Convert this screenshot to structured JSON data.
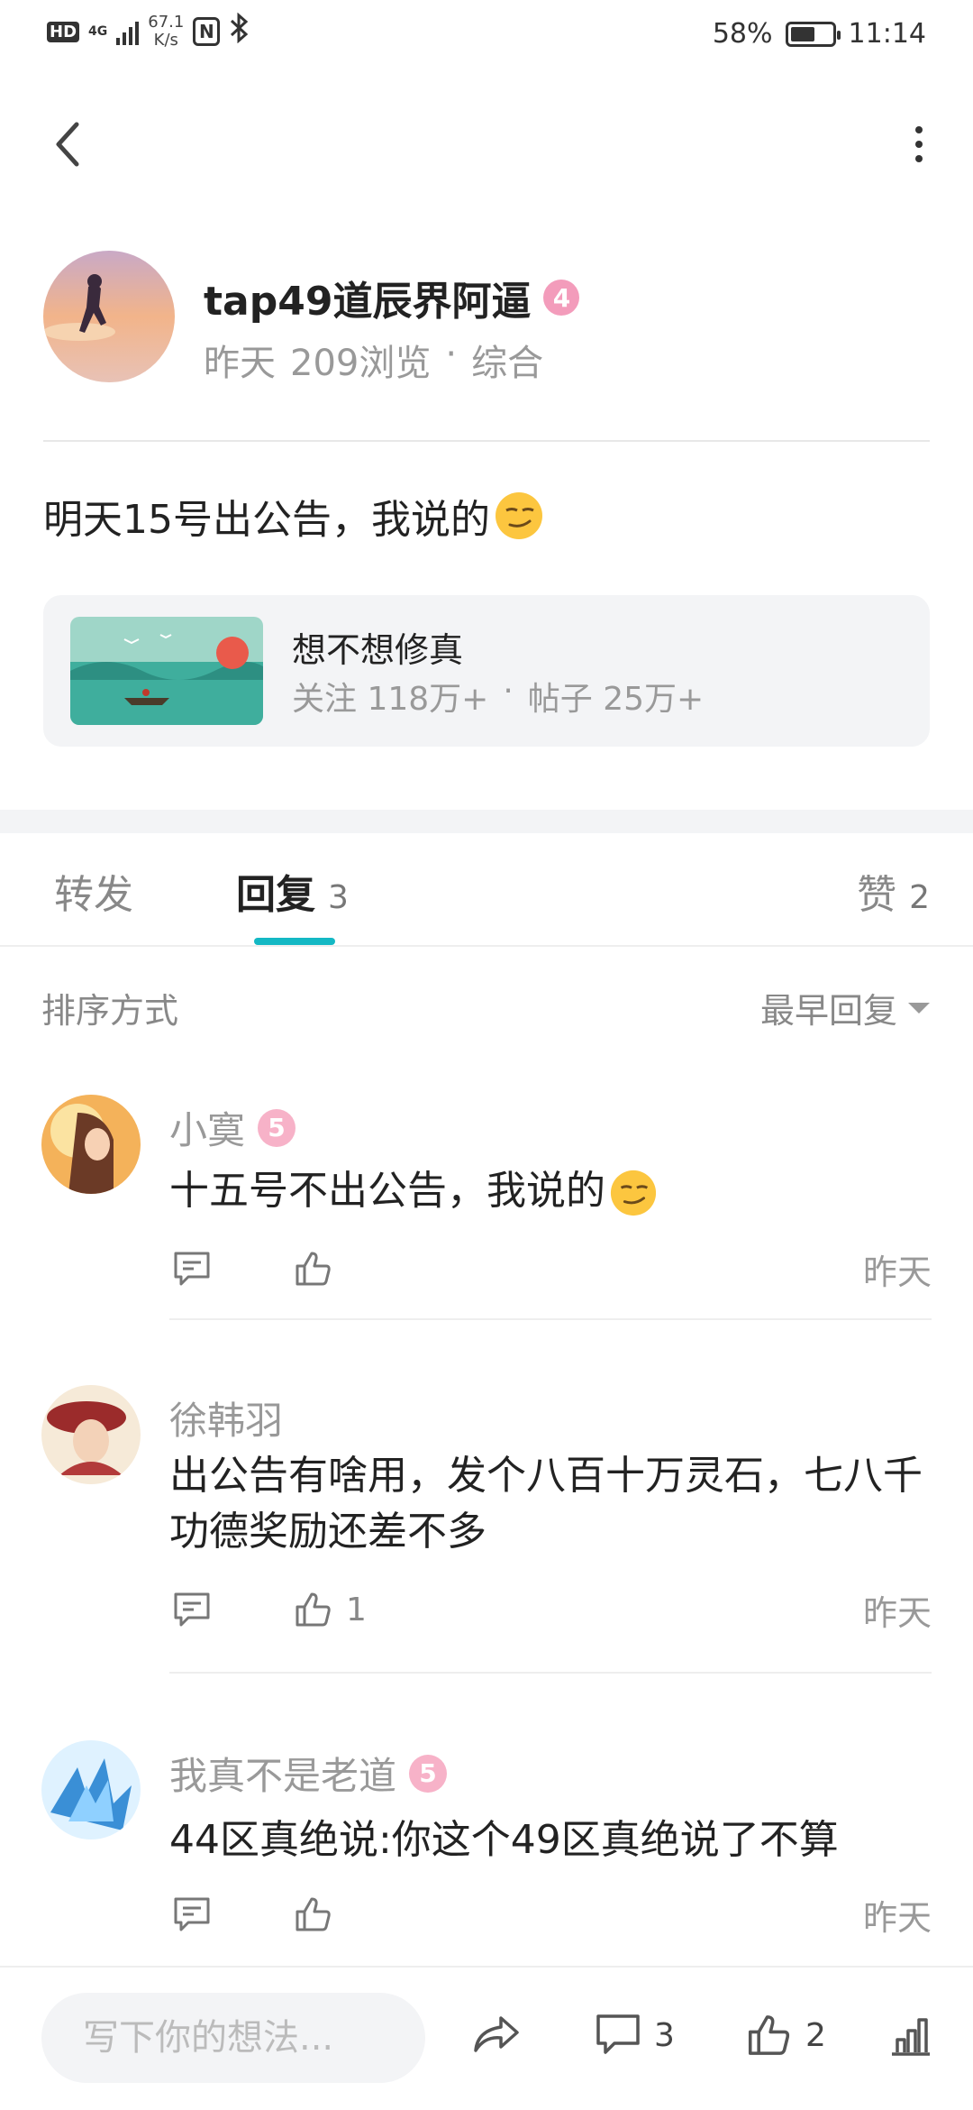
{
  "status_bar": {
    "hd": "HD",
    "network": "4G",
    "speed_value": "67.1",
    "speed_unit": "K/s",
    "battery_text": "58%",
    "battery_level": 0.58,
    "time": "11:14"
  },
  "author": {
    "name": "tap49道辰界阿逼",
    "level": "4",
    "time": "昨天",
    "views": "209浏览",
    "separator": "·",
    "category": "综合"
  },
  "post": {
    "text": "明天15号出公告，我说的",
    "emoji": "smirk-emoji"
  },
  "forum": {
    "name": "想不想修真",
    "followers": "关注 118万+",
    "separator": "·",
    "posts": "帖子 25万+"
  },
  "tabs": [
    {
      "label": "转发",
      "count": ""
    },
    {
      "label": "回复",
      "count": "3"
    },
    {
      "label": "赞",
      "count": "2"
    }
  ],
  "sort": {
    "label": "排序方式",
    "selected": "最早回复"
  },
  "comments": [
    {
      "name": "小寞",
      "level": "5",
      "text": "十五号不出公告，我说的",
      "likes": "",
      "time": "昨天"
    },
    {
      "name": "徐韩羽",
      "level": "",
      "text": "出公告有啥用，发个八百十万灵石，七八千功德奖励还差不多",
      "likes": "1",
      "time": "昨天"
    },
    {
      "name": "我真不是老道",
      "level": "5",
      "text": "44区真绝说:你这个49区真绝说了不算",
      "likes": "",
      "time": "昨天"
    }
  ],
  "bottom_bar": {
    "placeholder": "写下你的想法...",
    "comment_count": "3",
    "like_count": "2"
  },
  "colors": {
    "accent": "#14b8c4",
    "level_badge": "#f39cbb",
    "text_primary": "#222222",
    "text_secondary": "#999999"
  }
}
